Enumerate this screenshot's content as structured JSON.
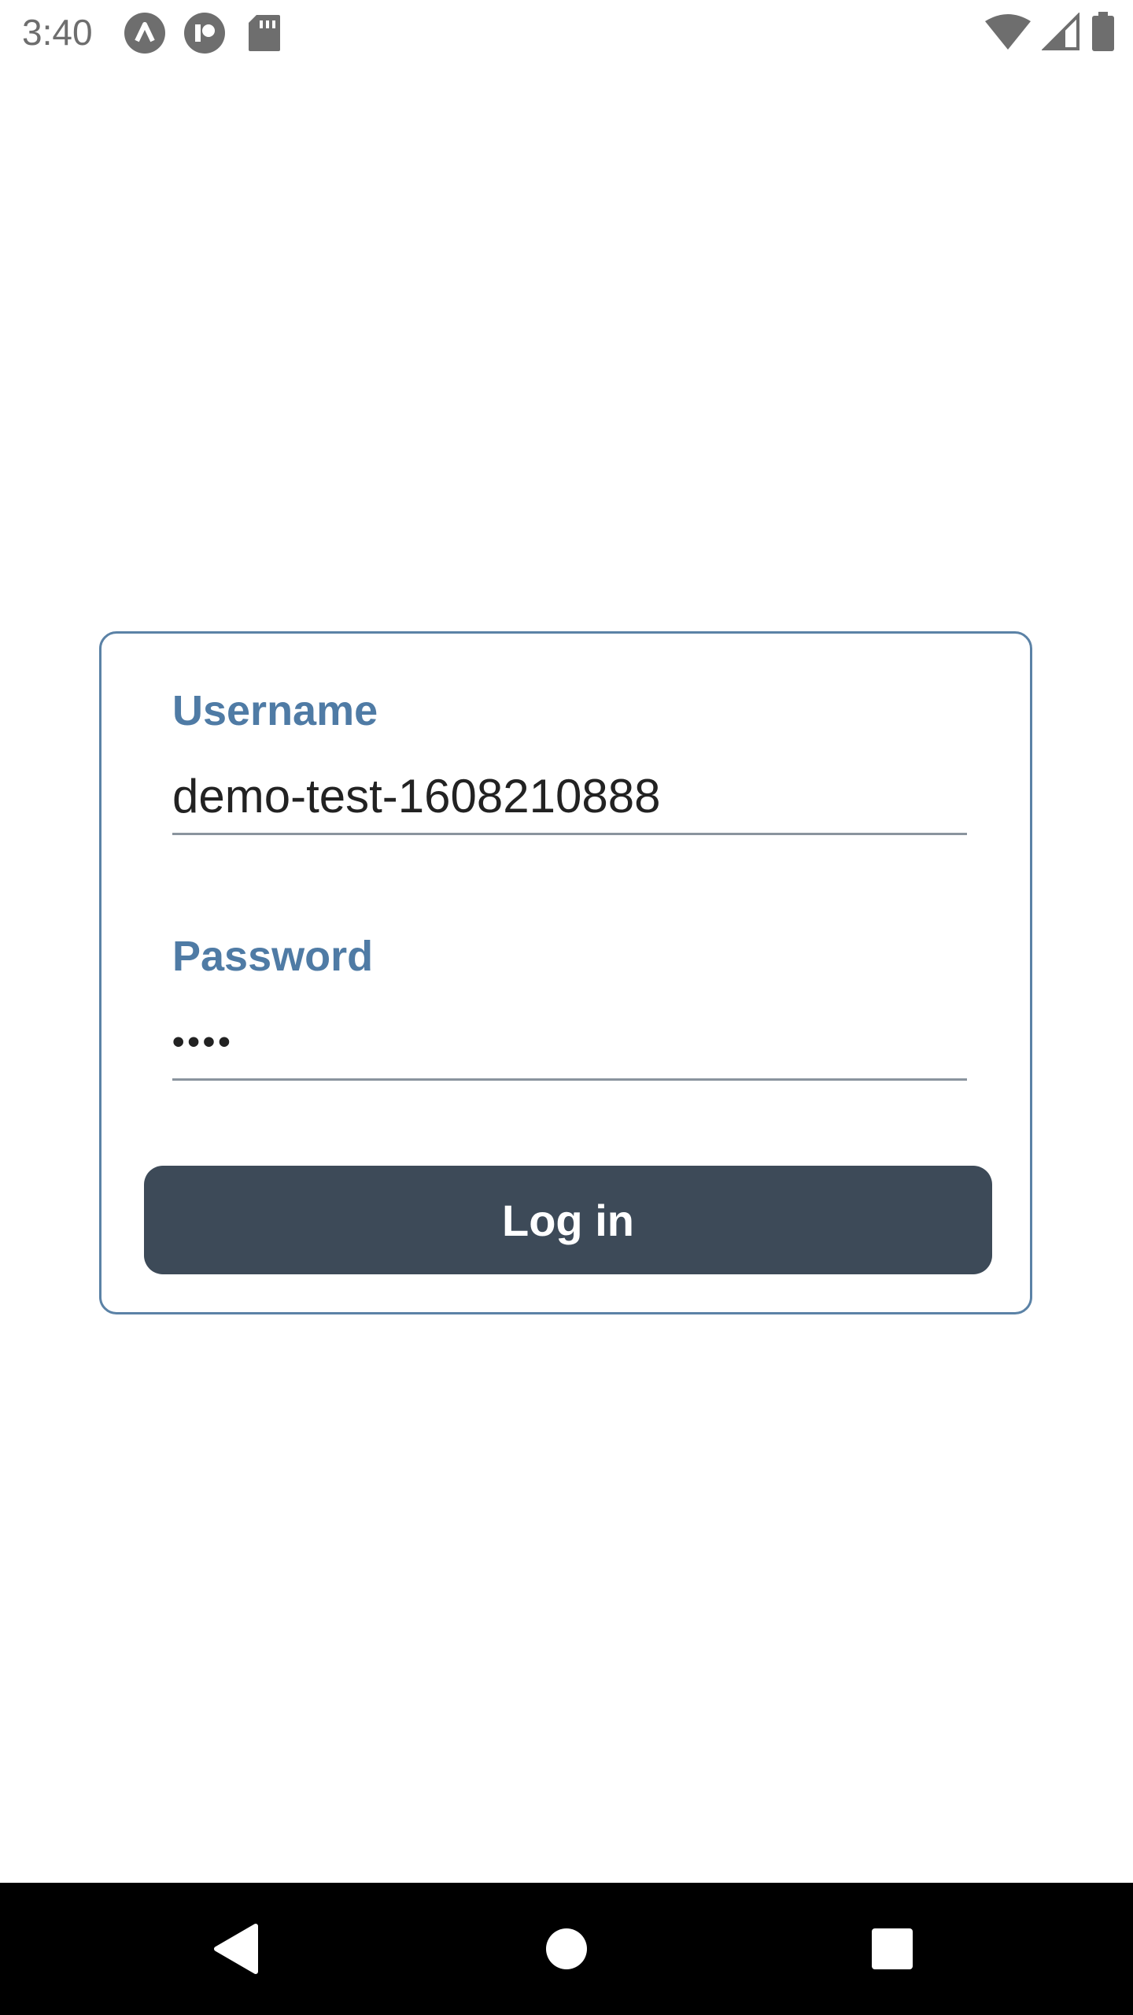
{
  "status_bar": {
    "time": "3:40",
    "left_icons": [
      "a-circle-icon",
      "r-circle-icon",
      "sd-card-icon"
    ],
    "right_icons": [
      "wifi-icon",
      "signal-icon",
      "battery-icon"
    ]
  },
  "login": {
    "username": {
      "label": "Username",
      "value": "demo-test-1608210888"
    },
    "password": {
      "label": "Password",
      "value": "••••"
    },
    "submit_label": "Log in"
  },
  "nav_bar": {
    "buttons": [
      "back-icon",
      "home-icon",
      "recents-icon"
    ]
  },
  "colors": {
    "card_border": "#5b82a6",
    "label": "#4f7ba5",
    "button_bg": "#3d4a58",
    "button_text": "#ffffff",
    "nav_bg": "#000000"
  }
}
